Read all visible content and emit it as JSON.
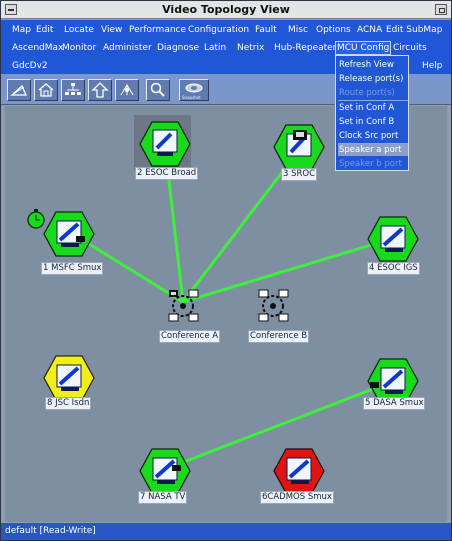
{
  "window": {
    "title": "Video Topology View"
  },
  "menubar": {
    "row1": [
      "Map",
      "Edit",
      "Locate",
      "View",
      "Performance",
      "Configuration",
      "Fault",
      "Misc",
      "Options",
      "ACNA",
      "Edit SubMap"
    ],
    "row2": [
      "AscendMax",
      "Monitor",
      "Administer",
      "Diagnose",
      "Latin",
      "Netrix",
      "Hub-Repeater",
      "MCU Config",
      "Circuits"
    ],
    "row3": [
      "GdcDv2"
    ],
    "help": "Help"
  },
  "dropdown": {
    "items": [
      {
        "label": "Refresh View",
        "state": "normal"
      },
      {
        "label": "Release port(s)",
        "state": "normal"
      },
      {
        "label": "Route port(s)",
        "state": "disabled"
      },
      {
        "label": "Set in Conf A",
        "state": "normal"
      },
      {
        "label": "Set in Conf B",
        "state": "normal"
      },
      {
        "label": "Clock Src port",
        "state": "normal"
      },
      {
        "label": "Speaker a port",
        "state": "highlighted"
      },
      {
        "label": "Speaker b port",
        "state": "disabled"
      }
    ]
  },
  "toolbar": {
    "tools": [
      "close-map-icon",
      "home-icon",
      "network-icon",
      "up-arrow-icon",
      "topology-icon",
      "search-icon",
      "snapshot-icon"
    ],
    "snapshot_label": "Snapshot"
  },
  "nodes": [
    {
      "id": "n1",
      "label": "1 MSFC Smux",
      "color": "green"
    },
    {
      "id": "n2",
      "label": "2 ESOC Broad",
      "color": "green"
    },
    {
      "id": "n3",
      "label": "3 SROC",
      "color": "green"
    },
    {
      "id": "n4",
      "label": "4 ESOC IGS",
      "color": "green"
    },
    {
      "id": "n5",
      "label": "5 DASA Smux",
      "color": "green"
    },
    {
      "id": "n6",
      "label": "6CADMOS Smux",
      "color": "red"
    },
    {
      "id": "n7",
      "label": "7 NASA TV",
      "color": "green"
    },
    {
      "id": "n8",
      "label": "8 JSC Isdn",
      "color": "yellow"
    }
  ],
  "conferences": [
    {
      "id": "confA",
      "label": "Conference A"
    },
    {
      "id": "confB",
      "label": "Conference B"
    }
  ],
  "colors": {
    "green": "#19d91c",
    "yellow": "#f2ef17",
    "red": "#e11414",
    "link": "#3cf03c"
  },
  "status": {
    "text": "default [Read-Write]"
  }
}
